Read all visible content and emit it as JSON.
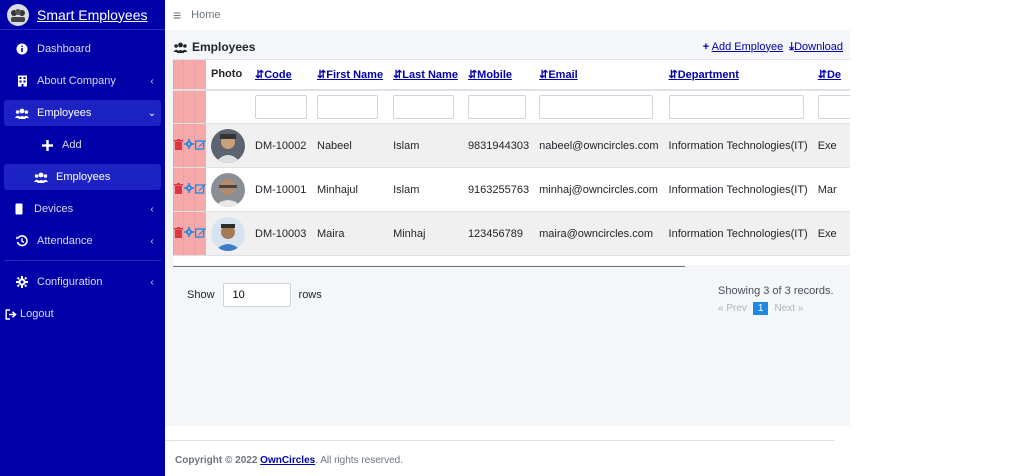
{
  "brand": {
    "name": "Smart Employees"
  },
  "sidebar": {
    "items": [
      {
        "label": "Dashboard",
        "icon": "info-circle-icon"
      },
      {
        "label": "About Company",
        "icon": "building-icon",
        "arrow": "‹"
      },
      {
        "label": "Employees",
        "icon": "users-icon",
        "arrow": "⌄"
      },
      {
        "label": "Add",
        "icon": "plus-icon"
      },
      {
        "label": "Employees",
        "icon": "users-icon"
      },
      {
        "label": "Devices",
        "icon": "device-icon",
        "arrow": "‹"
      },
      {
        "label": "Attendance",
        "icon": "history-icon",
        "arrow": "‹"
      },
      {
        "label": "Configuration",
        "icon": "gear-icon",
        "arrow": "‹"
      },
      {
        "label": "Logout",
        "icon": "logout-icon"
      }
    ]
  },
  "topbar": {
    "home": "Home"
  },
  "card": {
    "title": "Employees",
    "add_link": "Add Employee",
    "download_link": "Download"
  },
  "table": {
    "headers": {
      "photo": "Photo",
      "code": "Code",
      "first_name": "First Name",
      "last_name": "Last Name",
      "mobile": "Mobile",
      "email": "Email",
      "department": "Department",
      "designation": "De"
    },
    "rows": [
      {
        "code": "DM-10002",
        "first": "Nabeel",
        "last": "Islam",
        "mobile": "9831944303",
        "email": "nabeel@owncircles.com",
        "dept": "Information Technologies(IT)",
        "desig": "Exe"
      },
      {
        "code": "DM-10001",
        "first": "Minhajul",
        "last": "Islam",
        "mobile": "9163255763",
        "email": "minhaj@owncircles.com",
        "dept": "Information Technologies(IT)",
        "desig": "Mar"
      },
      {
        "code": "DM-10003",
        "first": "Maira",
        "last": "Minhaj",
        "mobile": "123456789",
        "email": "maira@owncircles.com",
        "dept": "Information Technologies(IT)",
        "desig": "Exe"
      }
    ]
  },
  "footer_controls": {
    "show_label": "Show",
    "rows_value": "10",
    "rows_label": "rows",
    "records_text": "Showing 3 of 3 records.",
    "prev": "« Prev",
    "page": "1",
    "next": "Next »"
  },
  "footer": {
    "prefix": "Copyright © 2022",
    "company": "OwnCircles",
    "suffix": ". All rights reserved."
  },
  "colors": {
    "sidebar_bg": "#0000a8",
    "action_cell": "#f5a9a9",
    "delete_icon": "#dc3545",
    "action_icon": "#1e88e5"
  }
}
